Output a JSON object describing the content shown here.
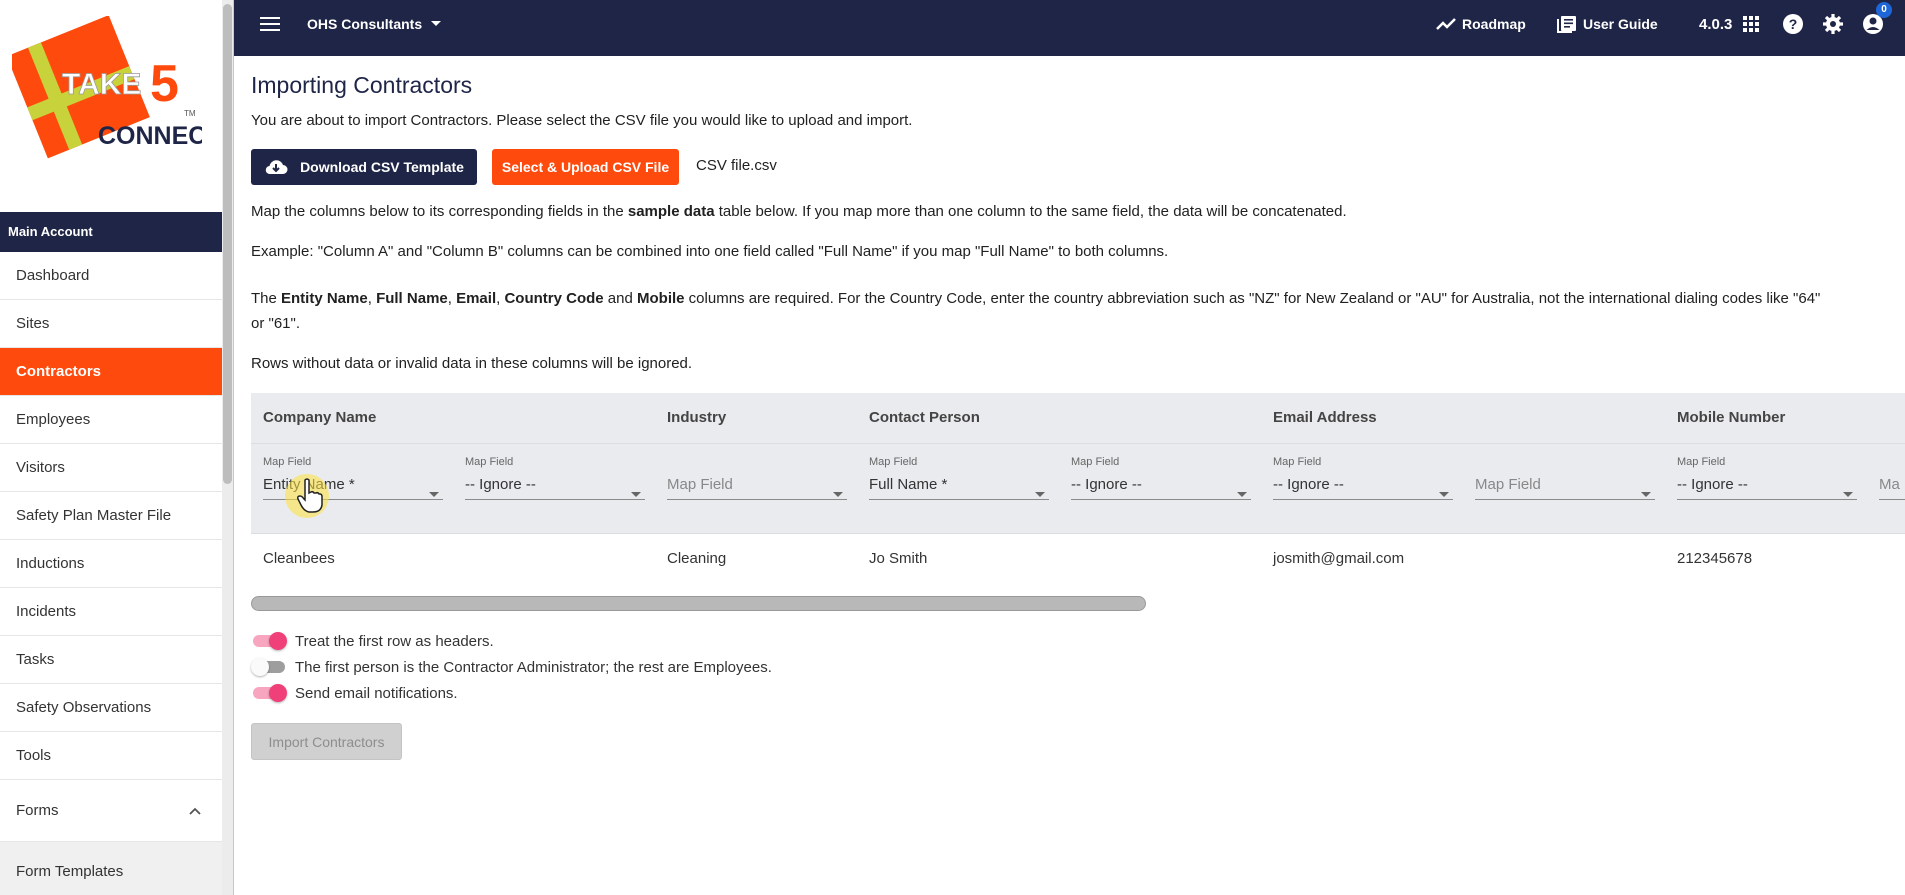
{
  "sidebar": {
    "logo_text_1": "TAKE",
    "logo_text_2": "5",
    "logo_text_3": "CONNECT",
    "logo_tm": "TM",
    "section_header": "Main Account",
    "items": [
      {
        "label": "Dashboard"
      },
      {
        "label": "Sites"
      },
      {
        "label": "Contractors"
      },
      {
        "label": "Employees"
      },
      {
        "label": "Visitors"
      },
      {
        "label": "Safety Plan Master File"
      },
      {
        "label": "Inductions"
      },
      {
        "label": "Incidents"
      },
      {
        "label": "Tasks"
      },
      {
        "label": "Safety Observations"
      },
      {
        "label": "Tools"
      },
      {
        "label": "Forms"
      },
      {
        "label": "Form Templates"
      }
    ]
  },
  "topbar": {
    "account": "OHS Consultants",
    "roadmap": "Roadmap",
    "user_guide": "User Guide",
    "version": "4.0.3",
    "notification_count": "0"
  },
  "page": {
    "title": "Importing Contractors",
    "intro": "You are about to import Contractors. Please select the CSV file you would like to upload and import.",
    "download_button": "Download CSV Template",
    "upload_button": "Select & Upload CSV File",
    "file_name": "CSV file.csv",
    "map_text_1": "Map the columns below to its corresponding fields in the ",
    "map_text_bold": "sample data",
    "map_text_2": " table below. If you map more than one column to the same field, the data will be concatenated.",
    "example_text": "Example: \"Column A\" and \"Column B\" columns can be combined into one field called \"Full Name\" if you map \"Full Name\" to both columns.",
    "req_1": "The ",
    "req_b1": "Entity Name",
    "req_sep1": ", ",
    "req_b2": "Full Name",
    "req_sep2": ", ",
    "req_b3": "Email",
    "req_sep3": ", ",
    "req_b4": "Country Code",
    "req_and": " and ",
    "req_b5": "Mobile",
    "req_2": " columns are required. For the Country Code, enter the country abbreviation such as \"NZ\" for New Zealand or \"AU\" for Australia, not the international dialing codes like \"64\"",
    "req_3": "or \"61\".",
    "rows_note": "Rows without data or invalid data in these columns will be ignored."
  },
  "table": {
    "headers": [
      "Company Name",
      "Industry",
      "Contact Person",
      "Email Address",
      "Mobile Number"
    ],
    "map_label": "Map Field",
    "selects": [
      "Entity Name *",
      "-- Ignore --",
      "Map Field",
      "Full Name *",
      "-- Ignore --",
      "-- Ignore --",
      "Map Field",
      "-- Ignore --",
      "Ma"
    ],
    "row": [
      "Cleanbees",
      "Cleaning",
      "Jo Smith",
      "josmith@gmail.com",
      "212345678"
    ]
  },
  "options": {
    "headers_toggle": "Treat the first row as headers.",
    "admin_toggle": "The first person is the Contractor Administrator; the rest are Employees.",
    "email_toggle": "Send email notifications.",
    "headers_on": true,
    "admin_on": false,
    "email_on": true
  },
  "import_button": "Import Contractors",
  "colors": {
    "navy": "#1f2547",
    "orange": "#ff4a0d",
    "toggle_pink": "#f0407a"
  }
}
